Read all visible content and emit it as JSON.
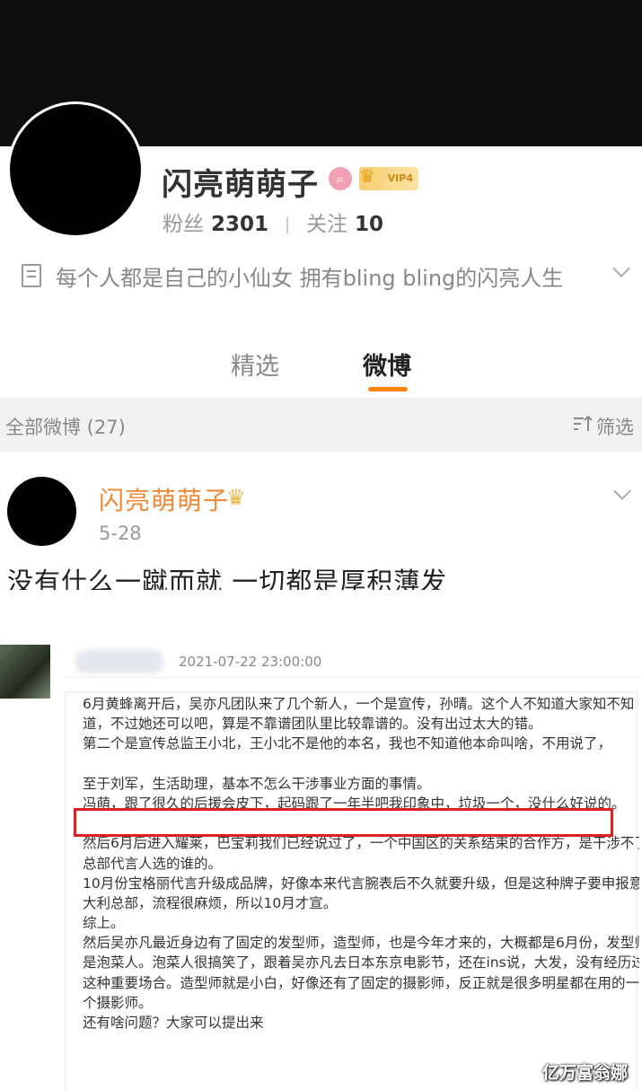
{
  "profile": {
    "name": "闪亮萌萌子",
    "vip_label": "VIP4",
    "fans_label": "粉丝",
    "fans_count": "2301",
    "follow_label": "关注",
    "follow_count": "10",
    "bio": "每个人都是自己的小仙女 拥有bling bling的闪亮人生"
  },
  "tabs": [
    {
      "label": "精选",
      "active": false
    },
    {
      "label": "微博",
      "active": true
    }
  ],
  "accent_color": "#ff8200",
  "filter": {
    "all_posts_label": "全部微博 (27)",
    "filter_label": "筛选"
  },
  "post": {
    "author": "闪亮萌萌子",
    "date": "5-28",
    "text": "没有什么一蹴而就 一切都是厚积薄发"
  },
  "embedded": {
    "timestamp": "2021-07-22 23:00:00",
    "lines": [
      "6月黄蜂离开后，吴亦凡团队来了几个新人，一个是宣传，孙晴。这个人不知道大家知不知",
      "道，不过她还可以吧，算是不靠谱团队里比较靠谱的。没有出过太大的错。",
      "第二个是宣传总监王小北，王小北不是他的本名，我也不知道他本命叫啥，不用说了，",
      "",
      "至于刘军，生活助理，基本不怎么干涉事业方面的事情。",
      "冯萌，跟了很久的后援会皮下，起码跟了一年半吧我印象中，垃圾一个，没什么好说的。",
      "",
      "然后6月后进入耀莱，巴宝莉我们已经说过了，一个中国区的关系结束的合作方，是干涉不了",
      "总部代言人选的谁的。",
      "10月份宝格丽代言升级成品牌，好像本来代言腕表后不久就要升级，但是这种牌子要申报意",
      "大利总部，流程很麻烦，所以10月才宣。",
      "综上。",
      "然后吴亦凡最近身边有了固定的发型师，造型师，也是今年才来的，大概都是6月份，发型师",
      "是泡菜人。泡菜人很搞笑了，跟着吴亦凡去日本东京电影节，还在ins说，大发，没有经历过",
      "这种重要场合。造型师就是小白，好像还有了固定的摄影师，反正就是很多明星都在用的一",
      "个摄影师。",
      "还有啥问题？大家可以提出来"
    ]
  },
  "watermark": "亿万富翁娜",
  "icons": [
    "search-icon",
    "crown-icon",
    "document-icon",
    "chevron-down-icon",
    "filter-icon"
  ]
}
